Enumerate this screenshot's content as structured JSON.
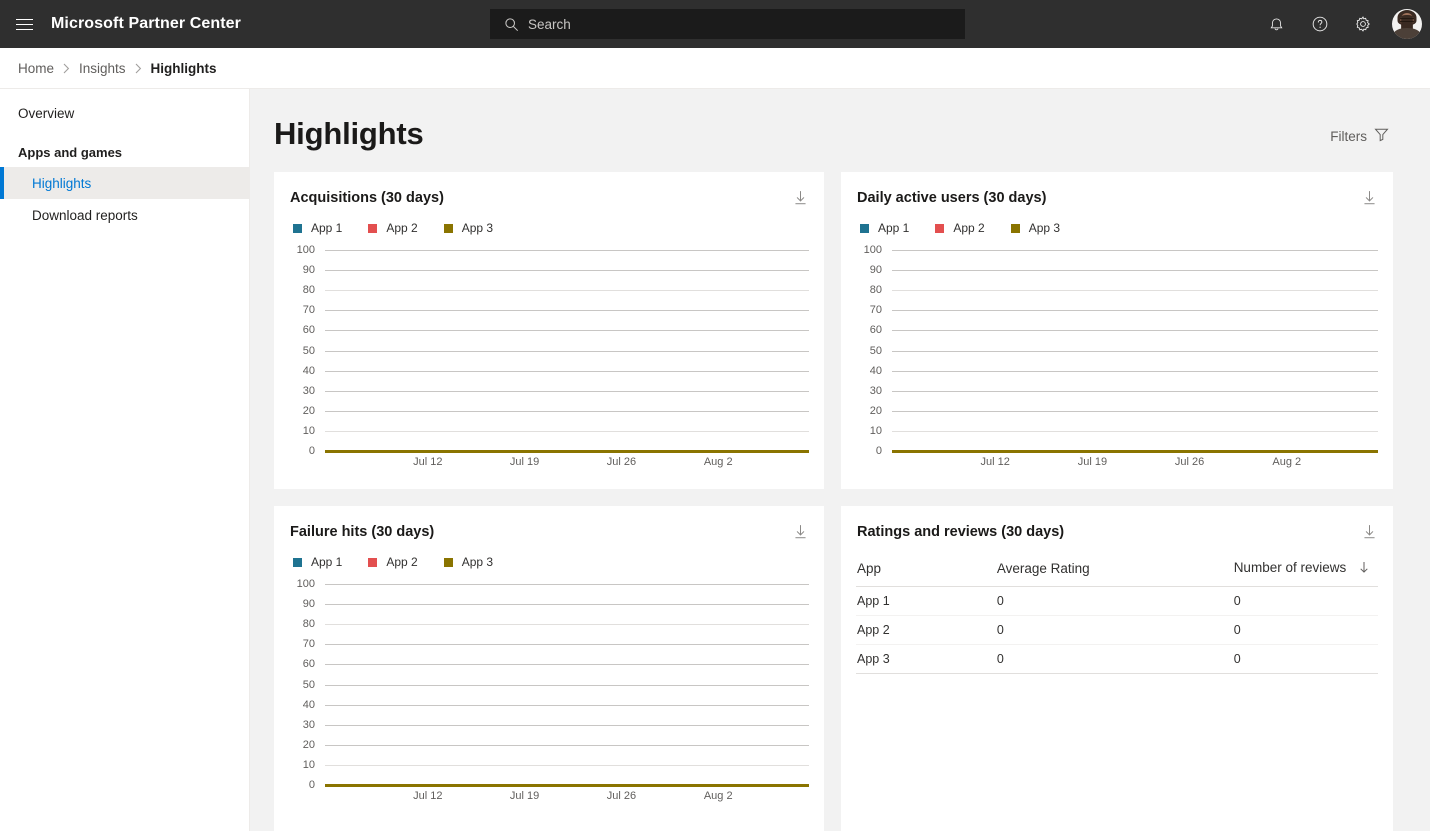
{
  "topbar": {
    "brand": "Microsoft Partner Center",
    "menu_icon": "hamburger-icon",
    "search": {
      "placeholder": "Search",
      "value": "",
      "icon": "search-icon"
    },
    "icons": [
      {
        "name": "notifications-bell-icon",
        "label": "Notifications"
      },
      {
        "name": "help-question-icon",
        "label": "Help"
      },
      {
        "name": "settings-gear-icon",
        "label": "Settings"
      }
    ],
    "avatar": {
      "name": "user-avatar",
      "label": "Account manager"
    },
    "background": "#2F2F2F"
  },
  "breadcrumb": {
    "items": [
      {
        "label": "Home",
        "current": false
      },
      {
        "label": "Insights",
        "current": false
      },
      {
        "label": "Highlights",
        "current": true
      }
    ],
    "separator": "›"
  },
  "sidebar": {
    "top_items": [
      {
        "label": "Overview",
        "selected": false
      }
    ],
    "group_title": "Apps and games",
    "items": [
      {
        "label": "Highlights",
        "selected": true
      },
      {
        "label": "Download reports",
        "selected": false
      }
    ],
    "accent_color": "#0078D4",
    "selected_bg": "#EDEBE9"
  },
  "page": {
    "title": "Highlights",
    "filters_label": "Filters",
    "filters_icon": "funnel-filter-icon",
    "background": "#F2F2F2"
  },
  "series_colors": {
    "app1": "#1F7391",
    "app2": "#E34F4F",
    "app3": "#8A7400"
  },
  "legend": [
    {
      "label": "App 1",
      "color": "#1F7391"
    },
    {
      "label": "App 2",
      "color": "#E34F4F"
    },
    {
      "label": "App 3",
      "color": "#8A7400"
    }
  ],
  "cards": {
    "acquisitions": {
      "title": "Acquisitions (30 days)",
      "download_icon": "download-arrow-icon"
    },
    "daily_active_users": {
      "title": "Daily active users (30 days)",
      "download_icon": "download-arrow-icon"
    },
    "failure_hits": {
      "title": "Failure hits (30 days)",
      "download_icon": "download-arrow-icon"
    },
    "ratings_reviews": {
      "title": "Ratings and reviews (30 days)",
      "download_icon": "download-arrow-icon"
    }
  },
  "ratings_table": {
    "columns": [
      "App",
      "Average Rating",
      "Number of reviews"
    ],
    "sorted_column": "Number of reviews",
    "sort_icon": "sort-descending-arrow-icon",
    "rows": [
      {
        "app": "App 1",
        "average_rating": "0",
        "number_of_reviews": "0"
      },
      {
        "app": "App 2",
        "average_rating": "0",
        "number_of_reviews": "0"
      },
      {
        "app": "App 3",
        "average_rating": "0",
        "number_of_reviews": "0"
      }
    ]
  },
  "chart_data": [
    {
      "id": "acquisitions",
      "type": "line",
      "title": "Acquisitions (30 days)",
      "xlabel": "",
      "ylabel": "",
      "ylim": [
        0,
        100
      ],
      "yticks": [
        0,
        10,
        20,
        30,
        40,
        50,
        60,
        70,
        80,
        90,
        100
      ],
      "xticks": [
        "Jul 12",
        "Jul 19",
        "Jul 26",
        "Aug 2"
      ],
      "grid": true,
      "legend_position": "top-left",
      "series": [
        {
          "name": "App 1",
          "color": "#1F7391",
          "values": [
            0,
            0,
            0,
            0
          ]
        },
        {
          "name": "App 2",
          "color": "#E34F4F",
          "values": [
            0,
            0,
            0,
            0
          ]
        },
        {
          "name": "App 3",
          "color": "#8A7400",
          "values": [
            0,
            0,
            0,
            0
          ]
        }
      ]
    },
    {
      "id": "daily_active_users",
      "type": "line",
      "title": "Daily active users (30 days)",
      "xlabel": "",
      "ylabel": "",
      "ylim": [
        0,
        100
      ],
      "yticks": [
        0,
        10,
        20,
        30,
        40,
        50,
        60,
        70,
        80,
        90,
        100
      ],
      "xticks": [
        "Jul 12",
        "Jul 19",
        "Jul 26",
        "Aug 2"
      ],
      "grid": true,
      "legend_position": "top-left",
      "series": [
        {
          "name": "App 1",
          "color": "#1F7391",
          "values": [
            0,
            0,
            0,
            0
          ]
        },
        {
          "name": "App 2",
          "color": "#E34F4F",
          "values": [
            0,
            0,
            0,
            0
          ]
        },
        {
          "name": "App 3",
          "color": "#8A7400",
          "values": [
            0,
            0,
            0,
            0
          ]
        }
      ]
    },
    {
      "id": "failure_hits",
      "type": "line",
      "title": "Failure hits (30 days)",
      "xlabel": "",
      "ylabel": "",
      "ylim": [
        0,
        100
      ],
      "yticks": [
        0,
        10,
        20,
        30,
        40,
        50,
        60,
        70,
        80,
        90,
        100
      ],
      "xticks": [
        "Jul 12",
        "Jul 19",
        "Jul 26",
        "Aug 2"
      ],
      "grid": true,
      "legend_position": "top-left",
      "series": [
        {
          "name": "App 1",
          "color": "#1F7391",
          "values": [
            0,
            0,
            0,
            0
          ]
        },
        {
          "name": "App 2",
          "color": "#E34F4F",
          "values": [
            0,
            0,
            0,
            0
          ]
        },
        {
          "name": "App 3",
          "color": "#8A7400",
          "values": [
            0,
            0,
            0,
            0
          ]
        }
      ]
    },
    {
      "id": "ratings_reviews",
      "type": "table",
      "title": "Ratings and reviews (30 days)",
      "columns": [
        "App",
        "Average Rating",
        "Number of reviews"
      ],
      "rows": [
        [
          "App 1",
          0,
          0
        ],
        [
          "App 2",
          0,
          0
        ],
        [
          "App 3",
          0,
          0
        ]
      ]
    }
  ]
}
